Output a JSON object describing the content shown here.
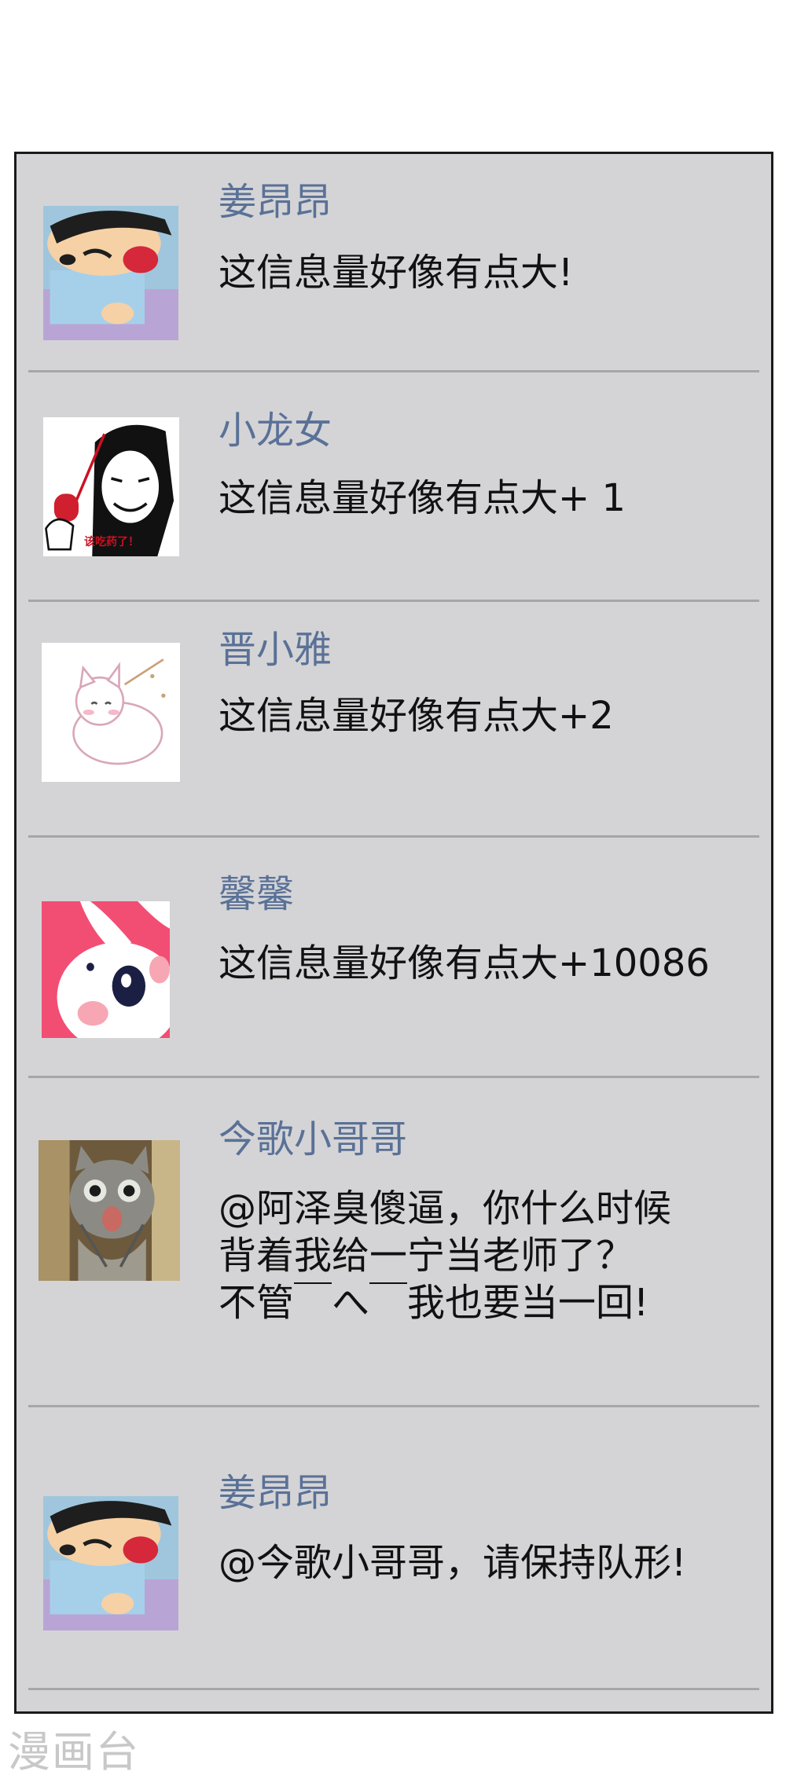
{
  "comments": [
    {
      "name": "姜昂昂",
      "text": "这信息量好像有点大!",
      "avatar": "crayon-boy-avatar"
    },
    {
      "name": "小龙女",
      "text": "这信息量好像有点大+ 1",
      "avatar": "meme-face-avatar",
      "avatar_caption": "该吃药了！"
    },
    {
      "name": "晋小雅",
      "text": "这信息量好像有点大+2",
      "avatar": "white-cat-avatar"
    },
    {
      "name": "馨馨",
      "text": "这信息量好像有点大+10086",
      "avatar": "pink-bunny-avatar"
    },
    {
      "name": "今歌小哥哥",
      "lines": [
        "@阿泽臭傻逼，你什么时候",
        "背着我给一宁当老师了？",
        "不管￣へ￣我也要当一回!"
      ],
      "avatar": "surprised-cat-avatar"
    },
    {
      "name": "姜昂昂",
      "text": "@今歌小哥哥，请保持队形!",
      "avatar": "crayon-boy-avatar"
    }
  ],
  "watermark": "漫画台",
  "colors": {
    "panel_bg": "#d4d4d6",
    "name": "#5a7197",
    "text": "#111111",
    "divider": "#a6a6a9",
    "border": "#1a1a1a"
  }
}
